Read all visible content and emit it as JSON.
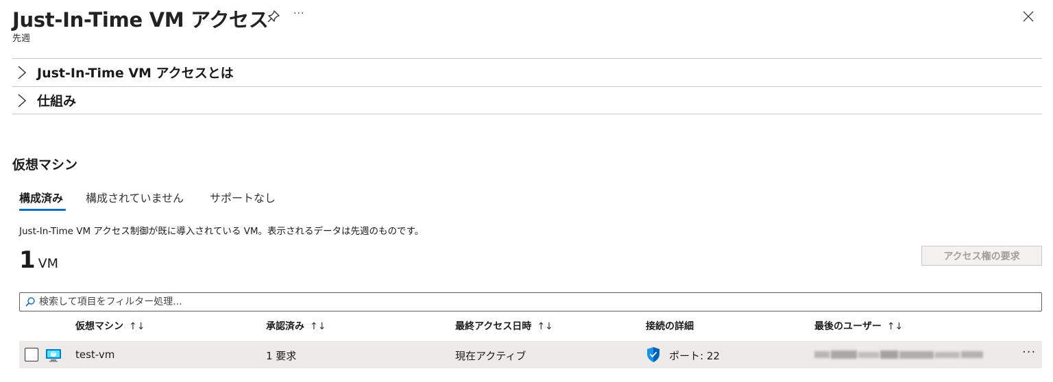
{
  "header": {
    "title": "Just-In-Time VM アクセス",
    "subtitle": "先週",
    "more_label": "···"
  },
  "accordions": [
    {
      "label": "Just-In-Time VM アクセスとは"
    },
    {
      "label": "仕組み"
    }
  ],
  "section": {
    "title": "仮想マシン"
  },
  "tabs": [
    {
      "label": "構成済み",
      "active": true
    },
    {
      "label": "構成されていません",
      "active": false
    },
    {
      "label": "サポートなし",
      "active": false
    }
  ],
  "description": "Just-In-Time VM アクセス制御が既に導入されている VM。表示されるデータは先週のものです。",
  "summary": {
    "count": "1",
    "unit": "VM"
  },
  "request_button_label": "アクセス権の要求",
  "search": {
    "placeholder": "検索して項目をフィルター処理..."
  },
  "table": {
    "sort_glyph": "↑↓",
    "columns": [
      {
        "label": "仮想マシン"
      },
      {
        "label": "承認済み"
      },
      {
        "label": "最終アクセス日時"
      },
      {
        "label": "接続の詳細"
      },
      {
        "label": "最後のユーザー"
      }
    ],
    "rows": [
      {
        "vm": "test-vm",
        "approved": "1 要求",
        "last_access": "現在アクティブ",
        "connection": "ポート: 22",
        "more": "···"
      }
    ]
  },
  "colors": {
    "accent": "#0f6cbd",
    "row_background": "#edebe9",
    "disabled_text": "#a19f9d"
  },
  "icons": [
    "pin-icon",
    "more-icon",
    "close-icon",
    "chevron-right-icon",
    "search-icon",
    "vm-icon",
    "shield-icon"
  ]
}
